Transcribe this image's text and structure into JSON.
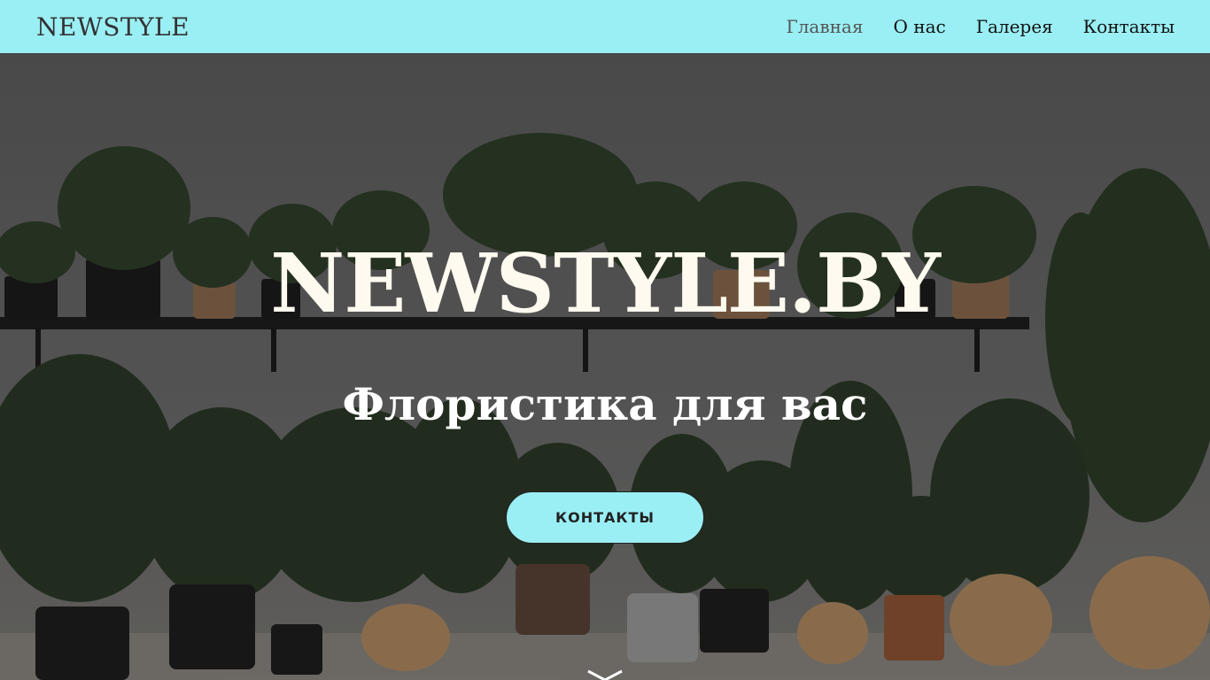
{
  "navbar": {
    "brand": "NEWSTYLE",
    "links": [
      {
        "label": "Главная",
        "active": true
      },
      {
        "label": "О нас",
        "active": false
      },
      {
        "label": "Галерея",
        "active": false
      },
      {
        "label": "Контакты",
        "active": false
      }
    ]
  },
  "hero": {
    "title": "NEWSTYLE.BY",
    "subtitle": "Флористика для вас",
    "cta_label": "КОНТАКТЫ",
    "scroll_icon": "chevron-down-icon"
  },
  "colors": {
    "accent": "#9aeff4",
    "title_text": "#fffaf0",
    "nav_text": "#111111"
  }
}
